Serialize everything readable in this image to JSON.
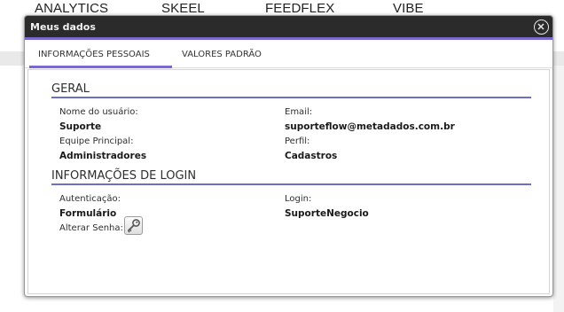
{
  "background_nav": {
    "items": [
      "ANALYTICS",
      "SKEEL",
      "FEEDFLEX",
      "VIBE"
    ]
  },
  "modal": {
    "title": "Meus dados",
    "close_icon": "close-circle-icon"
  },
  "tabs": [
    {
      "label": "INFORMAÇÕES PESSOAIS",
      "active": true
    },
    {
      "label": "VALORES PADRÃO",
      "active": false
    }
  ],
  "general": {
    "title": "GERAL",
    "username_label": "Nome do usuário:",
    "username_value": "Suporte",
    "email_label": "Email:",
    "email_value": "suporteflow@metadados.com.br",
    "team_label": "Equipe Principal:",
    "team_value": "Administradores",
    "profile_label": "Perfil:",
    "profile_value": "Cadastros"
  },
  "login": {
    "title": "INFORMAÇÕES DE LOGIN",
    "auth_label": "Autenticação:",
    "auth_value": "Formulário",
    "login_label": "Login:",
    "login_value": "SuporteNegocio",
    "change_password_label": "Alterar Senha:",
    "change_password_icon": "key-icon"
  },
  "colors": {
    "titlebar": "#2b2b2b",
    "accent": "#7a6bc9",
    "section_line": "#6f6fbf"
  }
}
